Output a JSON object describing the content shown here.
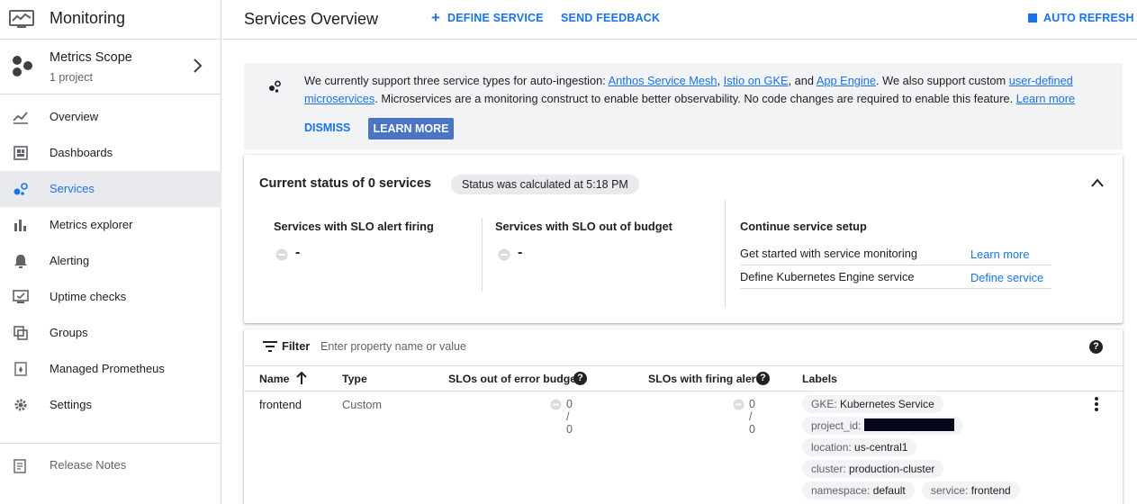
{
  "app": {
    "title": "Monitoring"
  },
  "scope": {
    "title": "Metrics Scope",
    "subtitle": "1 project"
  },
  "nav": [
    {
      "label": "Overview"
    },
    {
      "label": "Dashboards"
    },
    {
      "label": "Services",
      "active": true
    },
    {
      "label": "Metrics explorer"
    },
    {
      "label": "Alerting"
    },
    {
      "label": "Uptime checks"
    },
    {
      "label": "Groups"
    },
    {
      "label": "Managed Prometheus"
    },
    {
      "label": "Settings"
    }
  ],
  "release_notes": "Release Notes",
  "header": {
    "title": "Services Overview",
    "define_service": "DEFINE SERVICE",
    "send_feedback": "SEND FEEDBACK",
    "auto_refresh": "AUTO REFRESH"
  },
  "banner": {
    "t1": "We currently support three service types for auto-ingestion: ",
    "l1": "Anthos Service Mesh",
    "t2": ", ",
    "l2": "Istio on GKE",
    "t3": ", and ",
    "l3": "App Engine",
    "t4": ". We also support custom ",
    "l4": "user-defined microservices",
    "t5": ". Microservices are a monitoring construct to enable better observability. No code changes are required to enable this feature. ",
    "l5": "Learn more",
    "dismiss": "DISMISS",
    "learn_more": "LEARN MORE"
  },
  "status": {
    "title": "Current status of 0 services",
    "chip": "Status was calculated at 5:18 PM",
    "slo_alert_label": "Services with SLO alert firing",
    "slo_alert_value": "-",
    "slo_budget_label": "Services with SLO out of budget",
    "slo_budget_value": "-",
    "setup_title": "Continue service setup",
    "setup_rows": [
      {
        "label": "Get started with service monitoring",
        "link": "Learn more"
      },
      {
        "label": "Define Kubernetes Engine service",
        "link": "Define service"
      }
    ]
  },
  "filter": {
    "label": "Filter",
    "placeholder": "Enter property name or value"
  },
  "table": {
    "columns": [
      "Name",
      "Type",
      "SLOs out of error budget",
      "SLOs with firing alert",
      "Labels"
    ],
    "rows": [
      {
        "name": "frontend",
        "type": "Custom",
        "slo_budget": "0 / 0",
        "slo_alert": "0 / 0",
        "labels": [
          {
            "key": "GKE:",
            "value": "Kubernetes Service"
          },
          {
            "key": "project_id:",
            "value": ""
          },
          {
            "key": "location:",
            "value": "us-central1"
          },
          {
            "key": "cluster:",
            "value": "production-cluster"
          },
          {
            "key": "namespace:",
            "value": "default"
          },
          {
            "key": "service:",
            "value": "frontend"
          }
        ]
      }
    ]
  },
  "colors": {
    "accent": "#1a73e8",
    "button": "#4b74c6",
    "active_nav_bg": "#e8eaed",
    "banner_bg": "#f1f3f4"
  }
}
